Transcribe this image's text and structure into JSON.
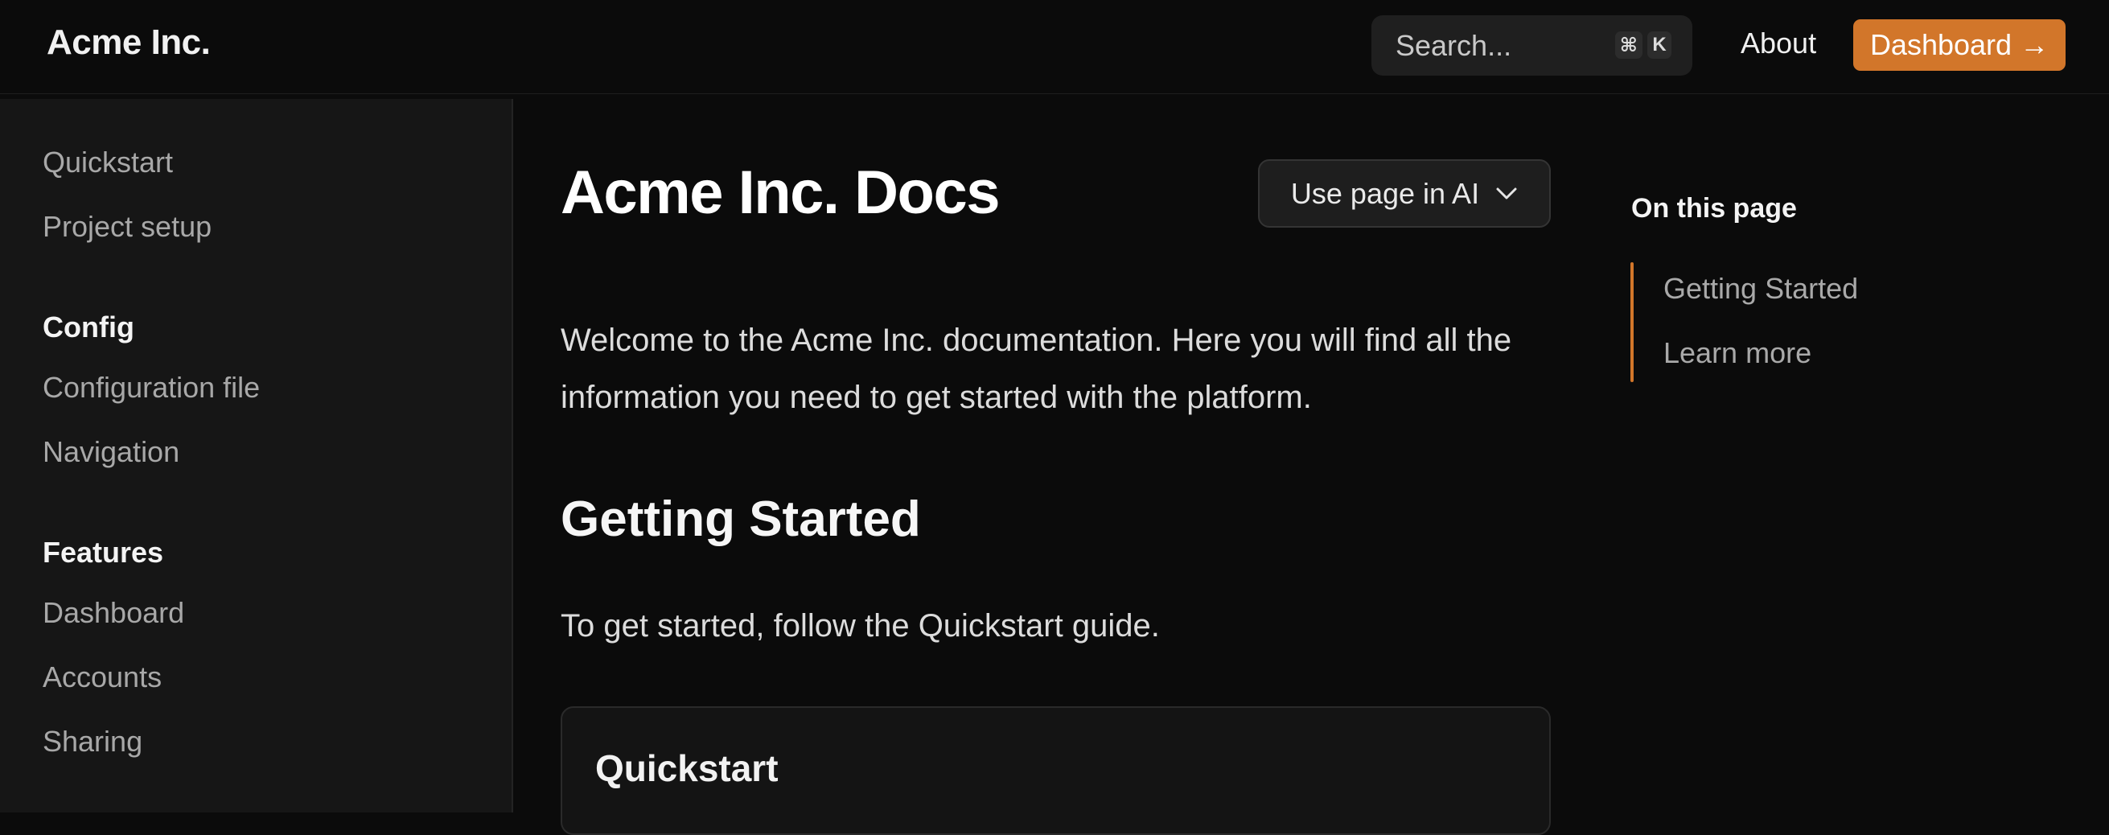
{
  "header": {
    "logo": "Acme Inc.",
    "search": {
      "placeholder": "Search...",
      "shortcut": [
        "⌘",
        "K"
      ]
    },
    "about_label": "About",
    "dashboard_label": "Dashboard",
    "dashboard_arrow": "→"
  },
  "sidebar": {
    "links_top": [
      "Quickstart",
      "Project setup"
    ],
    "sections": [
      {
        "heading": "Config",
        "items": [
          "Configuration file",
          "Navigation"
        ]
      },
      {
        "heading": "Features",
        "items": [
          "Dashboard",
          "Accounts",
          "Sharing"
        ]
      }
    ]
  },
  "main": {
    "title": "Acme Inc. Docs",
    "ai_button_label": "Use page in AI",
    "intro": "Welcome to the Acme Inc. documentation. Here you will find all the information you need to get started with the platform.",
    "section_heading": "Getting Started",
    "section_text": "To get started, follow the Quickstart guide.",
    "card_title": "Quickstart"
  },
  "toc": {
    "title": "On this page",
    "items": [
      "Getting Started",
      "Learn more"
    ]
  },
  "colors": {
    "accent": "#d2762a",
    "background": "#0b0b0b",
    "sidebar": "#161616"
  }
}
